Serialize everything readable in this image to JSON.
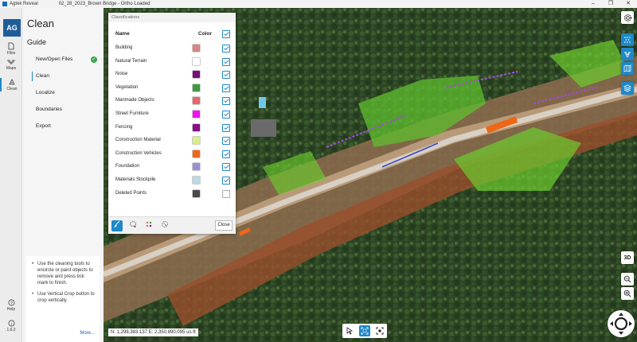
{
  "titlebar": {
    "app_name": "Agtek Reveal",
    "document": "02_28_2023_Brown Bridge - Ortho Loaded",
    "minimize": "–",
    "maximize": "❐",
    "close": "✕"
  },
  "rail": {
    "logo": "AG",
    "items": [
      {
        "label": "Files"
      },
      {
        "label": "Maps"
      },
      {
        "label": "Clean"
      }
    ],
    "help": "Help",
    "version": "1.6.2"
  },
  "guide": {
    "title": "Clean",
    "subtitle": "Guide",
    "steps": [
      {
        "label": "New/Open Files",
        "done": true
      },
      {
        "label": "Clean",
        "active": true
      },
      {
        "label": "Localize"
      },
      {
        "label": "Boundaries"
      },
      {
        "label": "Export"
      }
    ],
    "tips": [
      "Use the cleaning tools to encircle or paint objects to remove and press tick mark to finish.",
      "Use Vertical Crop button to crop vertically."
    ],
    "more": "More..."
  },
  "classifications": {
    "title": "Classifications",
    "col_name": "Name",
    "col_color": "Color",
    "close_label": "Close",
    "rows": [
      {
        "name": "Building",
        "color": "#d88481",
        "checked": true
      },
      {
        "name": "Natural Terrain",
        "color": "#ffffff",
        "checked": true
      },
      {
        "name": "Noise",
        "color": "#7a0d7a",
        "checked": true
      },
      {
        "name": "Vegetation",
        "color": "#3f9a3f",
        "checked": true
      },
      {
        "name": "Manmade Objects",
        "color": "#e6686b",
        "checked": true
      },
      {
        "name": "Street Furniture",
        "color": "#f013f0",
        "checked": true
      },
      {
        "name": "Fencing",
        "color": "#860e86",
        "checked": true
      },
      {
        "name": "Construction Material",
        "color": "#d9ef83",
        "checked": true
      },
      {
        "name": "Construction Vehicles",
        "color": "#ee6716",
        "checked": true
      },
      {
        "name": "Foundation",
        "color": "#9a8fd0",
        "checked": true
      },
      {
        "name": "Materials Stockpile",
        "color": "#b9d9e6",
        "checked": true
      },
      {
        "name": "Deleted Points",
        "color": "#4a4a4a",
        "checked": false
      }
    ]
  },
  "map": {
    "view_3d": "3D",
    "coordinates": "N: 1,298,383.137 E: 2,350,890.095 us-ft"
  },
  "colors": {
    "accent": "#1e88c8",
    "brand": "#1f5d99"
  }
}
